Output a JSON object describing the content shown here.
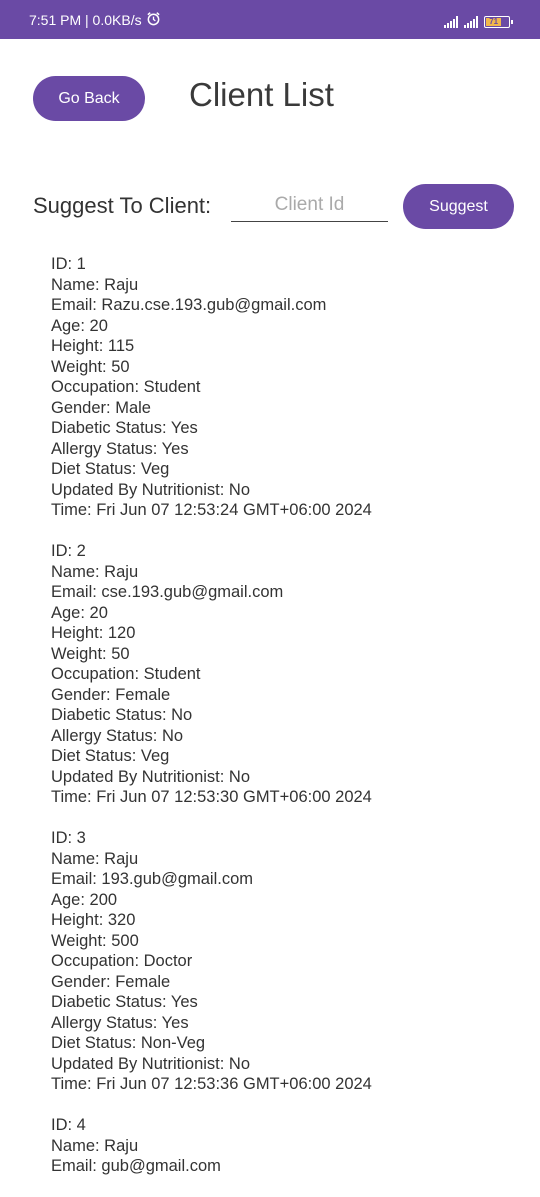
{
  "status_bar": {
    "time_text": "7:51 PM | 0.0KB/s",
    "battery_level": "71",
    "alarm_icon": "alarm-icon",
    "signal_icon": "signal-icon",
    "battery_icon": "battery-icon"
  },
  "header": {
    "back_label": "Go Back",
    "title": "Client List"
  },
  "suggest": {
    "label": "Suggest To Client:",
    "placeholder": "Client Id",
    "value": "",
    "button_label": "Suggest"
  },
  "colors": {
    "accent": "#6a4aa5",
    "text": "#333333"
  },
  "clients": [
    {
      "id": "ID: 1",
      "name": "Name: Raju",
      "email": "Email: Razu.cse.193.gub@gmail.com",
      "age": "Age: 20",
      "height": "Height: 115",
      "weight": "Weight: 50",
      "occupation": "Occupation: Student",
      "gender": "Gender: Male",
      "diabetic": "Diabetic Status: Yes",
      "allergy": "Allergy Status: Yes",
      "diet": "Diet Status: Veg",
      "updated": "Updated By Nutritionist: No",
      "time": "Time: Fri Jun 07 12:53:24 GMT+06:00 2024"
    },
    {
      "id": "ID: 2",
      "name": "Name: Raju",
      "email": "Email: cse.193.gub@gmail.com",
      "age": "Age: 20",
      "height": "Height: 120",
      "weight": "Weight: 50",
      "occupation": "Occupation: Student",
      "gender": "Gender: Female",
      "diabetic": "Diabetic Status: No",
      "allergy": "Allergy Status: No",
      "diet": "Diet Status: Veg",
      "updated": "Updated By Nutritionist: No",
      "time": "Time: Fri Jun 07 12:53:30 GMT+06:00 2024"
    },
    {
      "id": "ID: 3",
      "name": "Name: Raju",
      "email": "Email: 193.gub@gmail.com",
      "age": "Age: 200",
      "height": "Height: 320",
      "weight": "Weight: 500",
      "occupation": "Occupation: Doctor",
      "gender": "Gender: Female",
      "diabetic": "Diabetic Status: Yes",
      "allergy": "Allergy Status: Yes",
      "diet": "Diet Status: Non-Veg",
      "updated": "Updated By Nutritionist: No",
      "time": "Time: Fri Jun 07 12:53:36 GMT+06:00 2024"
    },
    {
      "id": "ID: 4",
      "name": "Name: Raju",
      "email": "Email: gub@gmail.com"
    }
  ]
}
